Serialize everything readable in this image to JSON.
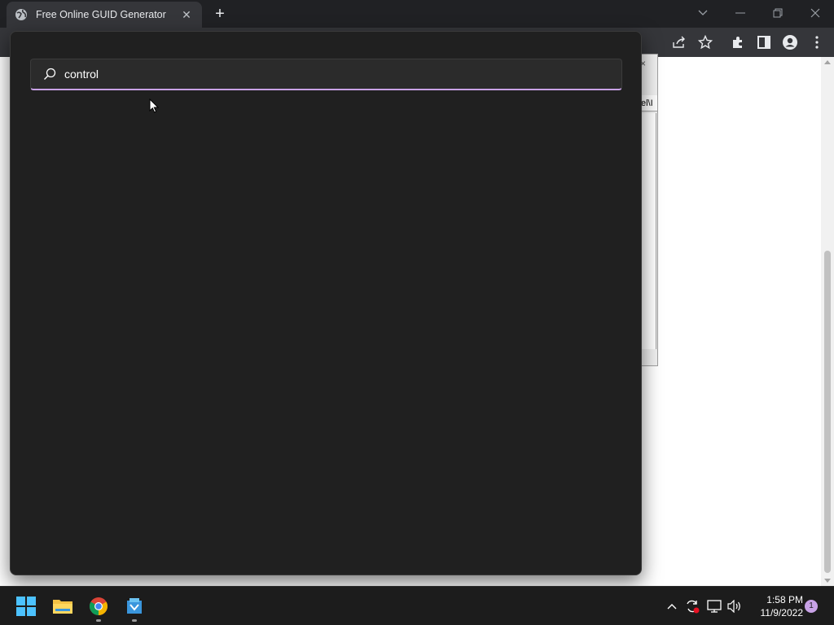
{
  "browser": {
    "tab_title": "Free Online GUID Generator",
    "tab_close": "✕",
    "new_tab": "+"
  },
  "page": {
    "dialog_path_fragment": "el\\I",
    "dialog_close": "×"
  },
  "search": {
    "query": "control"
  },
  "taskbar": {
    "time": "1:58 PM",
    "date": "11/9/2022",
    "notification_count": "1"
  },
  "colors": {
    "search_accent": "#c8a2e6",
    "panel_bg": "#202020",
    "taskbar_bg": "#1c1c1c"
  }
}
